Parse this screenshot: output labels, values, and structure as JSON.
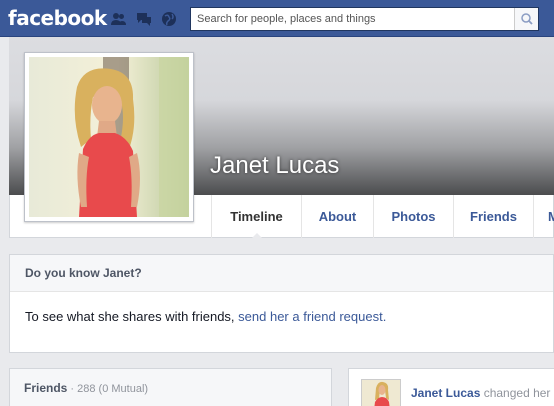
{
  "topbar": {
    "logo": "facebook",
    "search_placeholder": "Search for people, places and things",
    "icons": [
      "friend-requests-icon",
      "messages-icon",
      "notifications-globe-icon",
      "search-icon"
    ]
  },
  "profile": {
    "name": "Janet Lucas"
  },
  "tabs": [
    {
      "label": "Timeline",
      "active": true
    },
    {
      "label": "About",
      "active": false
    },
    {
      "label": "Photos",
      "active": false
    },
    {
      "label": "Friends",
      "active": false
    },
    {
      "label": "M",
      "active": false
    }
  ],
  "know_box": {
    "title": "Do you know Janet?",
    "text": "To see what she shares with friends, ",
    "link": "send her a friend request."
  },
  "friends": {
    "title": "Friends",
    "count": " · 288 (0 Mutual)"
  },
  "story": {
    "author": "Janet Lucas",
    "action": " changed her"
  },
  "colors": {
    "brand": "#3b5998",
    "background": "#e9eaed"
  }
}
